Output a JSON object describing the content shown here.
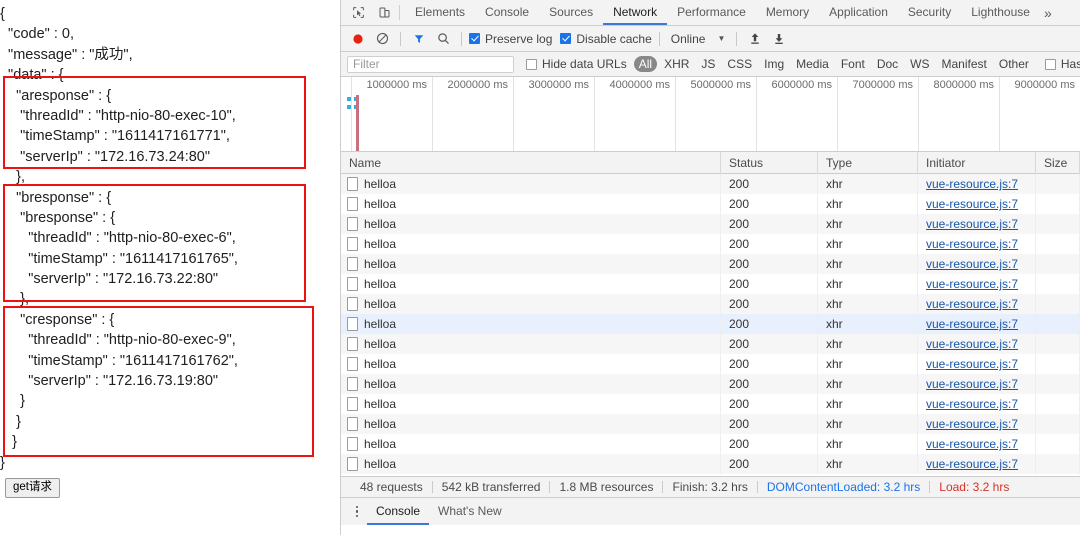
{
  "left_pane": {
    "json_lines": [
      "{",
      "  \"code\" : 0,",
      "  \"message\" : \"成功\",",
      "  \"data\" : {",
      "    \"aresponse\" : {",
      "     \"threadId\" : \"http-nio-80-exec-10\",",
      "     \"timeStamp\" : \"1611417161771\",",
      "     \"serverIp\" : \"172.16.73.24:80\"",
      "    },",
      "    \"bresponse\" : {",
      "     \"bresponse\" : {",
      "       \"threadId\" : \"http-nio-80-exec-6\",",
      "       \"timeStamp\" : \"1611417161765\",",
      "       \"serverIp\" : \"172.16.73.22:80\"",
      "     },",
      "     \"cresponse\" : {",
      "       \"threadId\" : \"http-nio-80-exec-9\",",
      "       \"timeStamp\" : \"1611417161762\",",
      "       \"serverIp\" : \"172.16.73.19:80\"",
      "     }",
      "    }",
      "   }",
      "}"
    ],
    "annotation_color": "#ee1111",
    "get_button_label": "get请求"
  },
  "devtools": {
    "icons": {
      "inspect": "inspect-element-icon",
      "device": "device-toolbar-icon",
      "record": "record-icon",
      "clear": "clear-icon",
      "filter": "filter-funnel-icon",
      "search": "search-icon",
      "import": "import-har-icon",
      "export": "export-har-icon",
      "overflow": "»"
    },
    "tabs": [
      {
        "label": "Elements",
        "active": false
      },
      {
        "label": "Console",
        "active": false
      },
      {
        "label": "Sources",
        "active": false
      },
      {
        "label": "Network",
        "active": true
      },
      {
        "label": "Performance",
        "active": false
      },
      {
        "label": "Memory",
        "active": false
      },
      {
        "label": "Application",
        "active": false
      },
      {
        "label": "Security",
        "active": false
      },
      {
        "label": "Lighthouse",
        "active": false
      }
    ],
    "controls": {
      "preserve_log": {
        "label": "Preserve log",
        "checked": true
      },
      "disable_cache": {
        "label": "Disable cache",
        "checked": true
      },
      "throttling": "Online"
    },
    "filterbar": {
      "filter_placeholder": "Filter",
      "filter_value": "",
      "hide_data_urls": {
        "label": "Hide data URLs",
        "checked": false
      },
      "types": [
        "All",
        "XHR",
        "JS",
        "CSS",
        "Img",
        "Media",
        "Font",
        "Doc",
        "WS",
        "Manifest",
        "Other"
      ],
      "selected_type": "All",
      "has_blocked": {
        "label": "Has blocked c",
        "checked": false
      }
    },
    "overview": {
      "ticks": [
        "1000000 ms",
        "2000000 ms",
        "3000000 ms",
        "4000000 ms",
        "5000000 ms",
        "6000000 ms",
        "7000000 ms",
        "8000000 ms",
        "9000000 ms"
      ]
    },
    "table": {
      "columns": [
        "Name",
        "Status",
        "Type",
        "Initiator",
        "Size"
      ],
      "rows": [
        {
          "name": "helloa",
          "status": "200",
          "type": "xhr",
          "initiator": "vue-resource.js:7",
          "size": "",
          "selected": false
        },
        {
          "name": "helloa",
          "status": "200",
          "type": "xhr",
          "initiator": "vue-resource.js:7",
          "size": "",
          "selected": false
        },
        {
          "name": "helloa",
          "status": "200",
          "type": "xhr",
          "initiator": "vue-resource.js:7",
          "size": "",
          "selected": false
        },
        {
          "name": "helloa",
          "status": "200",
          "type": "xhr",
          "initiator": "vue-resource.js:7",
          "size": "",
          "selected": false
        },
        {
          "name": "helloa",
          "status": "200",
          "type": "xhr",
          "initiator": "vue-resource.js:7",
          "size": "",
          "selected": false
        },
        {
          "name": "helloa",
          "status": "200",
          "type": "xhr",
          "initiator": "vue-resource.js:7",
          "size": "",
          "selected": false
        },
        {
          "name": "helloa",
          "status": "200",
          "type": "xhr",
          "initiator": "vue-resource.js:7",
          "size": "",
          "selected": false
        },
        {
          "name": "helloa",
          "status": "200",
          "type": "xhr",
          "initiator": "vue-resource.js:7",
          "size": "",
          "selected": true
        },
        {
          "name": "helloa",
          "status": "200",
          "type": "xhr",
          "initiator": "vue-resource.js:7",
          "size": "",
          "selected": false
        },
        {
          "name": "helloa",
          "status": "200",
          "type": "xhr",
          "initiator": "vue-resource.js:7",
          "size": "",
          "selected": false
        },
        {
          "name": "helloa",
          "status": "200",
          "type": "xhr",
          "initiator": "vue-resource.js:7",
          "size": "",
          "selected": false
        },
        {
          "name": "helloa",
          "status": "200",
          "type": "xhr",
          "initiator": "vue-resource.js:7",
          "size": "",
          "selected": false
        },
        {
          "name": "helloa",
          "status": "200",
          "type": "xhr",
          "initiator": "vue-resource.js:7",
          "size": "",
          "selected": false
        },
        {
          "name": "helloa",
          "status": "200",
          "type": "xhr",
          "initiator": "vue-resource.js:7",
          "size": "",
          "selected": false
        },
        {
          "name": "helloa",
          "status": "200",
          "type": "xhr",
          "initiator": "vue-resource.js:7",
          "size": "",
          "selected": false
        }
      ]
    },
    "summary": {
      "requests": "48 requests",
      "transferred": "542 kB transferred",
      "resources": "1.8 MB resources",
      "finish": "Finish: 3.2 hrs",
      "dom_content_loaded": "DOMContentLoaded: 3.2 hrs",
      "load": "Load: 3.2 hrs",
      "dcl_color": "#1a73e8",
      "load_color": "#d93025"
    },
    "drawer": {
      "tabs": [
        {
          "label": "Console",
          "active": true
        },
        {
          "label": "What's New",
          "active": false
        }
      ]
    }
  }
}
